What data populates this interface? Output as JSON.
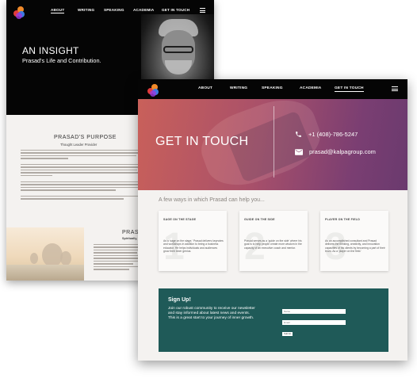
{
  "back_page": {
    "nav": [
      "ABOUT",
      "WRITING",
      "SPEAKING",
      "ACADEMIA",
      "GET IN TOUCH"
    ],
    "hero_title": "AN INSIGHT",
    "hero_subtitle": "Prasad's Life and Contribution.",
    "purpose_title": "PRASAD'S PURPOSE",
    "purpose_subtitle": "Thought Leader Provider",
    "section_title": "PRASA",
    "section_subtitle": "Spiritually, Yo"
  },
  "front_page": {
    "nav": {
      "about": "ABOUT",
      "writing": "WRITING",
      "speaking": "SPEAKING",
      "academia": "ACADEMIA",
      "contact": "GET IN TOUCH"
    },
    "hero_title": "GET IN TOUCH",
    "phone": "+1 (408)-786-5247",
    "email": "prasad@kalpagroup.com",
    "ways_heading": "A few ways in which Prasad can help you...",
    "cards": [
      {
        "number": "1",
        "title": "SAGE ON THE STAGE",
        "body": "As a 'sage on the stage,' Prasad delivers keynotes and workshops in addition to being a business educator. He helps individuals and audiences grow their inner genius."
      },
      {
        "number": "2",
        "title": "GUIDE ON THE SIDE",
        "body": "Prasad serves as a 'guide on the side' where his goal is to help people create more wisdom in the capacity of an executive coach and mentor."
      },
      {
        "number": "3",
        "title": "PLAYER ON THE FIELD",
        "body": "As an accomplished consultant and Prasad delivers the thinking, creativity, and innovation capacities of his clients by becoming a part of their team. As a 'player on the field.'"
      }
    ],
    "signup": {
      "title": "Sign Up!",
      "body": "Join our robust community to receive our newsletter and stay informed about latest news and events.\nThis is a great start to your journey of inner growth.",
      "name_placeholder": "Name",
      "email_placeholder": "Email",
      "submit_label": "Submit"
    }
  },
  "colors": {
    "nav_bg": "#050505",
    "hero_gradient_start": "#c9605a",
    "hero_gradient_end": "#6a3a6e",
    "signup_bg": "#1f5a58"
  }
}
